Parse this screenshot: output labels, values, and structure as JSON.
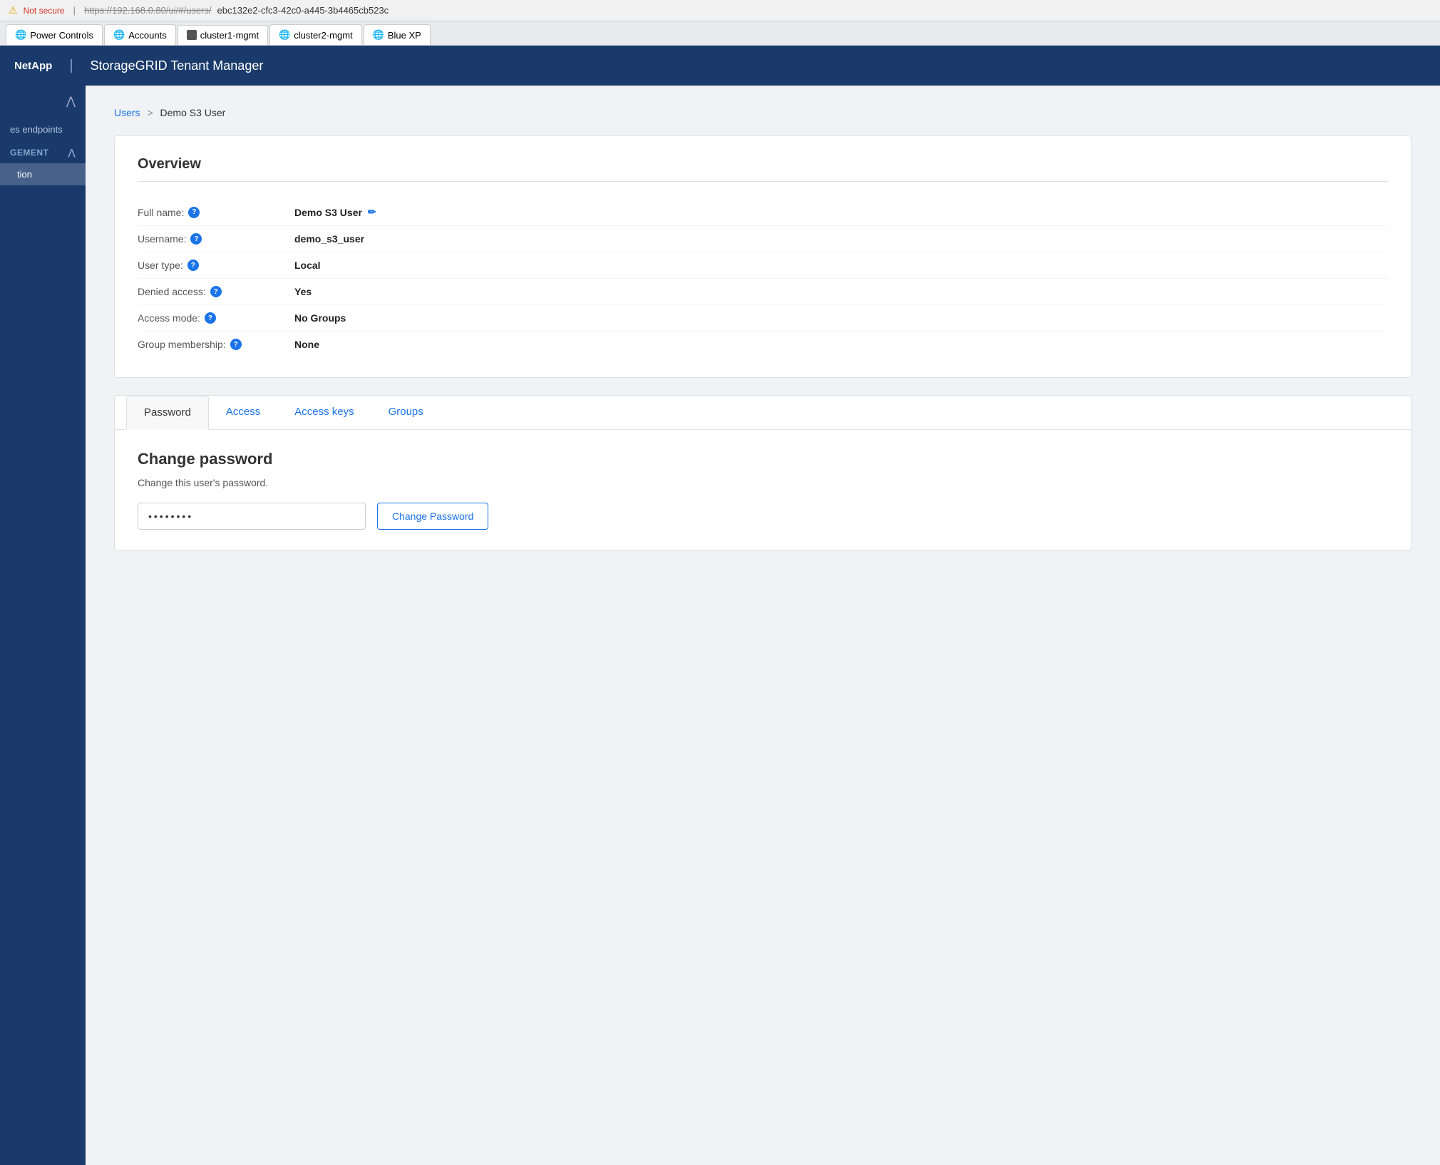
{
  "browser": {
    "warning_icon": "⚠",
    "not_secure_label": "Not secure",
    "url_crossed": "https://192.168.0.80/ui/#/users/",
    "url_path": "ebc132e2-cfc3-42c0-a445-3b4465cb523c"
  },
  "tabs": [
    {
      "id": "power-controls",
      "label": "Power Controls",
      "icon": "globe"
    },
    {
      "id": "accounts",
      "label": "Accounts",
      "icon": "globe"
    },
    {
      "id": "cluster1-mgmt",
      "label": "cluster1-mgmt",
      "icon": "square"
    },
    {
      "id": "cluster2-mgmt",
      "label": "cluster2-mgmt",
      "icon": "globe"
    },
    {
      "id": "blue-xp",
      "label": "Blue XP",
      "icon": "globe"
    }
  ],
  "header": {
    "brand": "NetApp",
    "divider": "|",
    "app_title": "StorageGRID Tenant Manager"
  },
  "sidebar": {
    "toggle_icon": "^",
    "endpoints_label": "es endpoints",
    "section_label": "GEMENT",
    "section_icon": "^",
    "active_item": "tion"
  },
  "breadcrumb": {
    "parent_label": "Users",
    "separator": ">",
    "current_label": "Demo S3 User"
  },
  "overview": {
    "title": "Overview",
    "fields": [
      {
        "label": "Full name:",
        "value": "Demo S3 User",
        "has_edit": true
      },
      {
        "label": "Username:",
        "value": "demo_s3_user",
        "has_edit": false
      },
      {
        "label": "User type:",
        "value": "Local",
        "has_edit": false
      },
      {
        "label": "Denied access:",
        "value": "Yes",
        "has_edit": false
      },
      {
        "label": "Access mode:",
        "value": "No Groups",
        "has_edit": false
      },
      {
        "label": "Group membership:",
        "value": "None",
        "has_edit": false
      }
    ]
  },
  "tabs_section": {
    "tabs": [
      {
        "id": "password",
        "label": "Password",
        "active": true
      },
      {
        "id": "access",
        "label": "Access",
        "active": false
      },
      {
        "id": "access-keys",
        "label": "Access keys",
        "active": false
      },
      {
        "id": "groups",
        "label": "Groups",
        "active": false
      }
    ],
    "password_tab": {
      "title": "Change password",
      "description": "Change this user's password.",
      "input_placeholder": "••••••••",
      "button_label": "Change Password"
    }
  },
  "help_icon_label": "?"
}
